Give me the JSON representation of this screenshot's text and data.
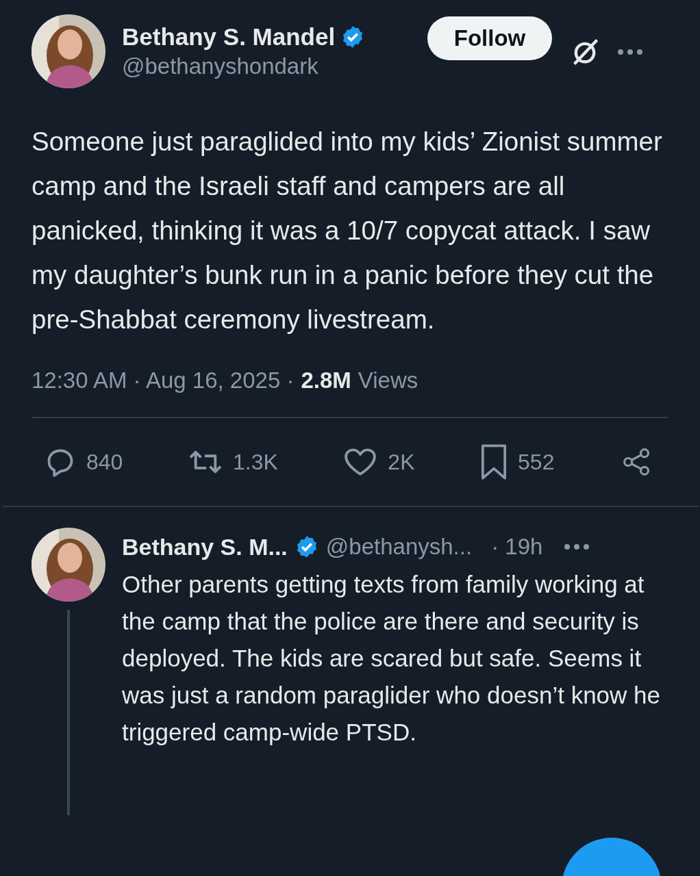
{
  "post": {
    "author": {
      "name": "Bethany S. Mandel",
      "handle": "@bethanyshondark",
      "verified": true
    },
    "follow_button": "Follow",
    "text": "Someone just paraglided into my kids’ Zionist summer camp and the Israeli staff and campers are all panicked, thinking it was a 10/7 copycat attack. I saw my daughter’s bunk run in a panic before they cut the pre-Shabbat ceremony livestream.",
    "timestamp": "12:30 AM · Aug 16, 2025 ·",
    "views_count": "2.8M",
    "views_label": "Views",
    "actions": [
      {
        "kind": "reply",
        "count": "840"
      },
      {
        "kind": "repost",
        "count": "1.3K"
      },
      {
        "kind": "like",
        "count": "2K"
      },
      {
        "kind": "bookmark",
        "count": "552"
      },
      {
        "kind": "share"
      }
    ]
  },
  "reply": {
    "author": {
      "name": "Bethany S. M...",
      "handle": "@bethanysh...",
      "verified": true
    },
    "time": "· 19h",
    "text": "Other parents getting texts from family working at the camp that the police are there and security is deployed. The kids are scared but safe. Seems it was just a random paraglider who doesn’t know he triggered camp-wide PTSD."
  }
}
